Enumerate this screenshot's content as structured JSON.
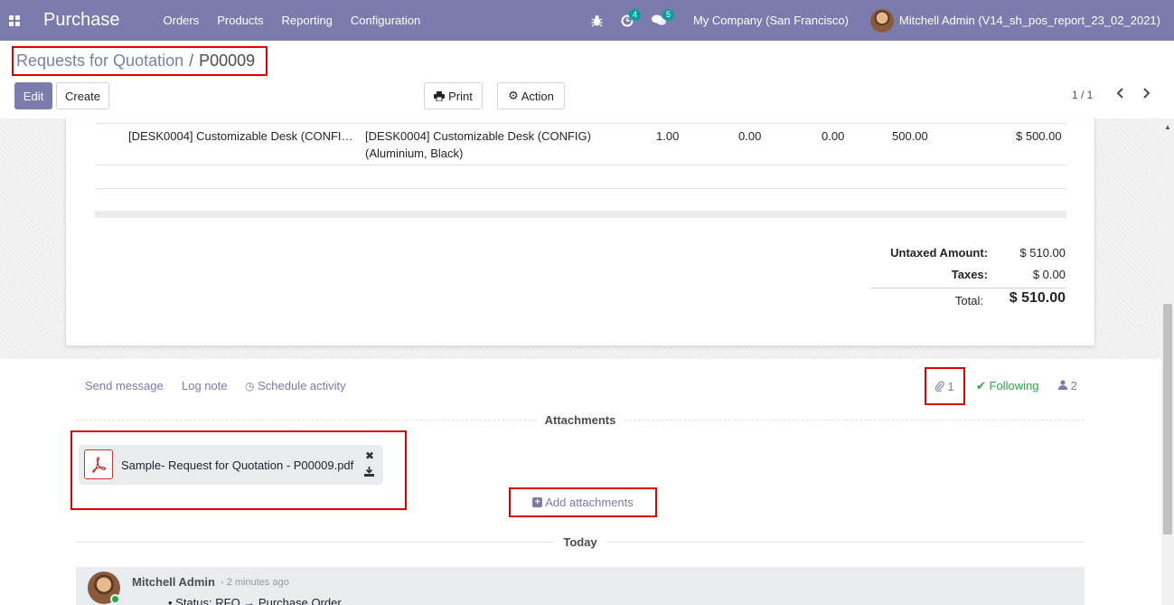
{
  "navbar": {
    "app_title": "Purchase",
    "menu": [
      "Orders",
      "Products",
      "Reporting",
      "Configuration"
    ],
    "activity_count": "4",
    "message_count": "5",
    "company": "My Company (San Francisco)",
    "user": "Mitchell Admin (V14_sh_pos_report_23_02_2021)"
  },
  "breadcrumb": {
    "parent": "Requests for Quotation",
    "separator": "/",
    "current": "P00009"
  },
  "buttons": {
    "edit": "Edit",
    "create": "Create",
    "print": "Print",
    "action": "Action"
  },
  "pager": {
    "value": "1 / 1"
  },
  "order_line": {
    "product": "[DESK0004] Customizable Desk (CONFI…",
    "description_line1": "[DESK0004] Customizable Desk (CONFIG)",
    "description_line2": "(Aluminium, Black)",
    "quantity": "1.00",
    "received": "0.00",
    "billed": "0.00",
    "unit_price": "500.00",
    "subtotal": "$ 500.00"
  },
  "totals": {
    "untaxed_label": "Untaxed Amount:",
    "untaxed_value": "$ 510.00",
    "taxes_label": "Taxes:",
    "taxes_value": "$ 0.00",
    "total_label": "Total:",
    "total_value": "$ 510.00"
  },
  "chatter": {
    "send_message": "Send message",
    "log_note": "Log note",
    "schedule_activity": "Schedule activity",
    "attachment_count": "1",
    "following": "Following",
    "follower_count": "2",
    "attachments_title": "Attachments",
    "attachment_name": "Sample- Request for Quotation - P00009.pdf",
    "add_attachments": "Add attachments",
    "today_title": "Today",
    "message_author": "Mitchell Admin",
    "message_date": "- 2 minutes ago",
    "message_body": "Status: RFQ → Purchase Order"
  },
  "colors": {
    "brand": "#7c7bad",
    "highlight": "#dd0000",
    "following": "#28a745"
  }
}
